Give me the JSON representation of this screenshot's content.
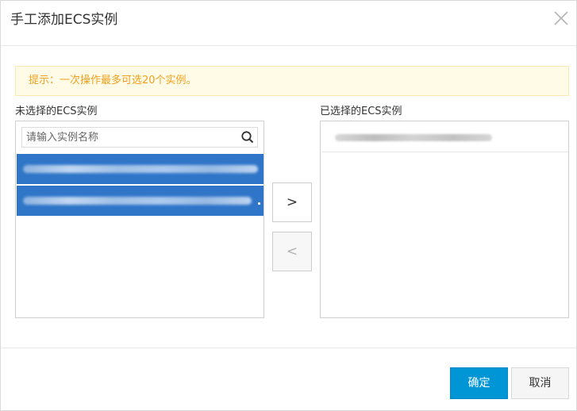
{
  "dialog": {
    "title": "手工添加ECS实例",
    "close_icon": "close-icon"
  },
  "tip": {
    "text": "提示：一次操作最多可选20个实例。",
    "color": "#f0a020",
    "background": "#fffbe6"
  },
  "available": {
    "label": "未选择的ECS实例",
    "search_placeholder": "请输入实例名称",
    "search_value": "",
    "search_icon": "search-icon",
    "selected_color": "#2f75c8"
  },
  "selected": {
    "label": "已选择的ECS实例"
  },
  "transfer": {
    "move_right_label": ">",
    "move_left_label": "<"
  },
  "footer": {
    "ok_label": "确定",
    "cancel_label": "取消",
    "ok_color": "#0096d6"
  }
}
